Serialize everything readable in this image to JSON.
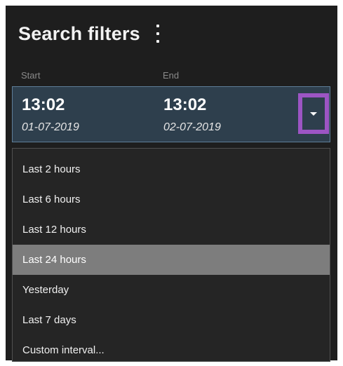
{
  "header": {
    "title": "Search filters",
    "menu_icon": "more-vertical-icon"
  },
  "range": {
    "start_label": "Start",
    "end_label": "End",
    "start_time": "13:02",
    "start_date": "01-07-2019",
    "end_time": "13:02",
    "end_date": "02-07-2019",
    "dropdown_icon": "caret-down-icon",
    "highlight_color": "#9c55c4"
  },
  "menu": {
    "items": [
      {
        "label": "Last 2 hours"
      },
      {
        "label": "Last 6 hours"
      },
      {
        "label": "Last 12 hours"
      },
      {
        "label": "Last 24 hours",
        "selected": true
      },
      {
        "label": "Yesterday"
      },
      {
        "label": "Last 7 days"
      },
      {
        "label": "Custom interval..."
      }
    ]
  }
}
